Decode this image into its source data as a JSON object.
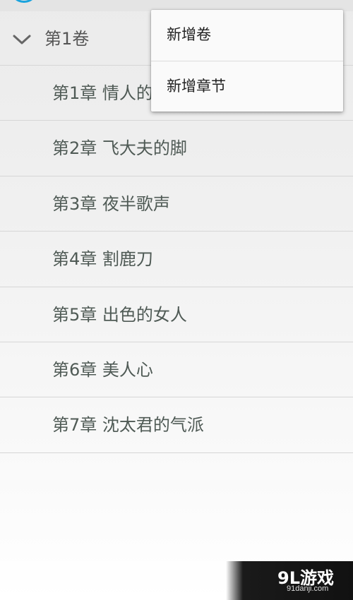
{
  "volume": {
    "title": "第1卷",
    "expand_icon": "chevron-down-icon"
  },
  "chapters": [
    {
      "label": "第1章 情人的"
    },
    {
      "label": "第2章 飞大夫的脚"
    },
    {
      "label": "第3章 夜半歌声"
    },
    {
      "label": "第4章 割鹿刀"
    },
    {
      "label": "第5章 出色的女人"
    },
    {
      "label": "第6章 美人心"
    },
    {
      "label": "第7章 沈太君的气派"
    }
  ],
  "popup_menu": {
    "items": [
      {
        "label": "新增卷"
      },
      {
        "label": "新增章节"
      }
    ]
  },
  "watermark": {
    "main": "9L游戏",
    "sub": "91danji.com"
  },
  "colors": {
    "accent": "#1aa3dd",
    "chapter_text": "#4f5a55",
    "divider": "#d6d6d6"
  }
}
